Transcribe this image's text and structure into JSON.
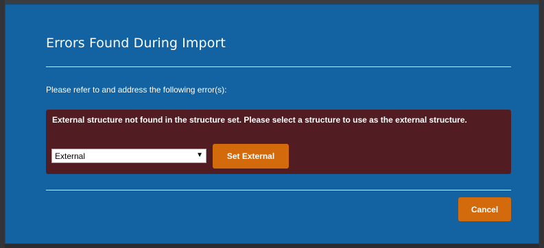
{
  "dialog": {
    "title": "Errors Found During Import",
    "intro": "Please refer to and address the following error(s):",
    "error": {
      "message": "External structure not found in the structure set. Please select a structure to use as the external structure.",
      "select_value": "External",
      "set_button_label": "Set External"
    },
    "cancel_label": "Cancel"
  },
  "colors": {
    "dialog_bg": "#1362a1",
    "error_bg": "#521d22",
    "button_bg": "#d36a0c"
  }
}
